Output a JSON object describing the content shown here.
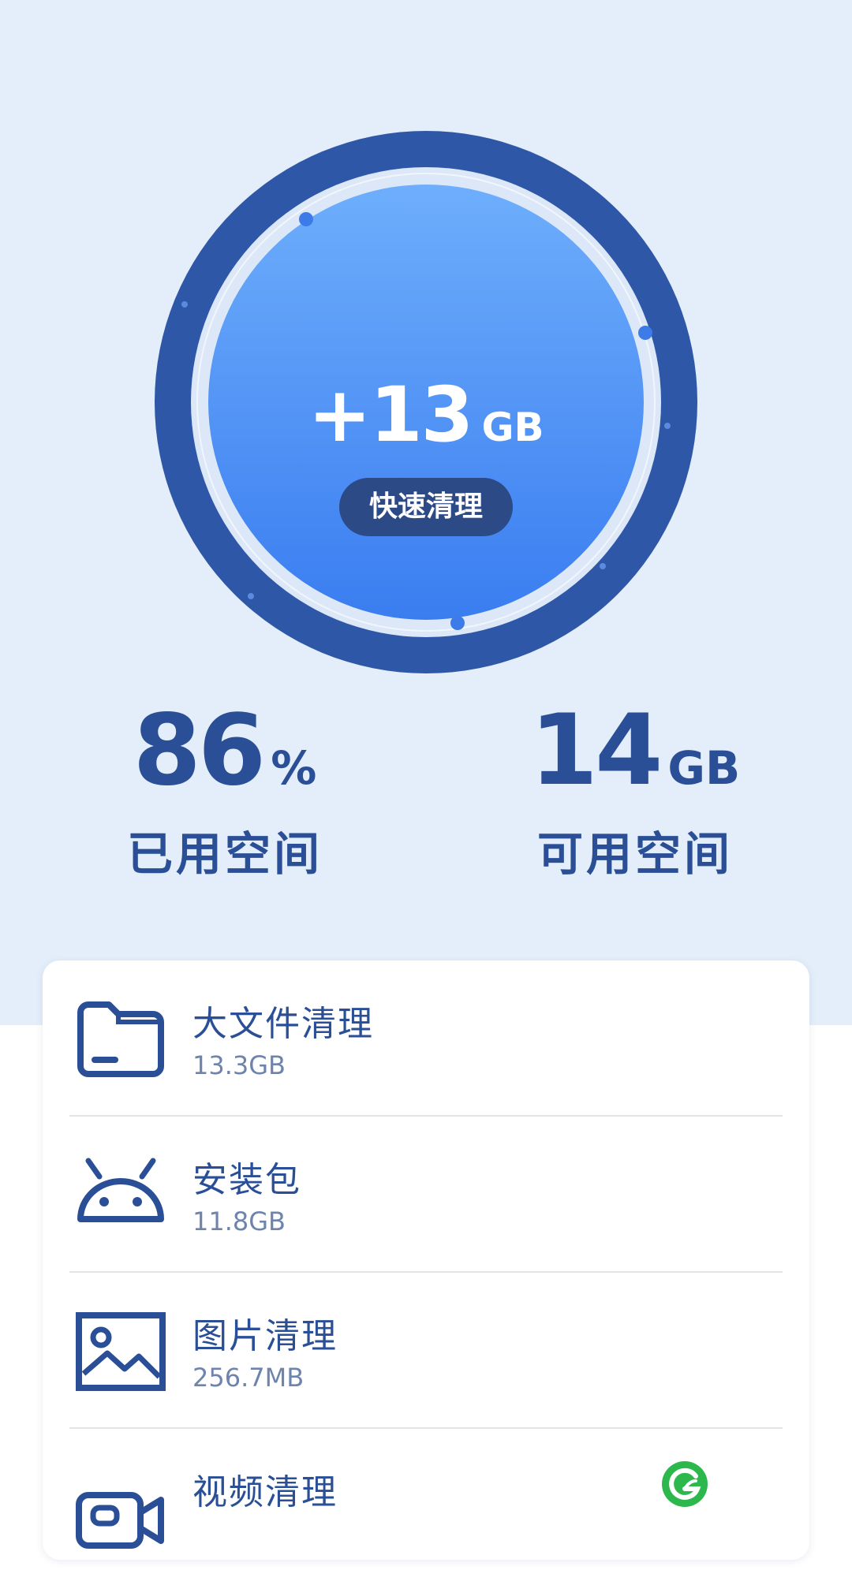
{
  "gauge": {
    "value": "+13",
    "unit": "GB",
    "button_label": "快速清理",
    "used_fraction": 0.86
  },
  "stats": {
    "used": {
      "value": "86",
      "unit": "%",
      "label": "已用空间"
    },
    "free": {
      "value": "14",
      "unit": "GB",
      "label": "可用空间"
    }
  },
  "list": {
    "items": [
      {
        "title": "大文件清理",
        "size": "13.3GB",
        "icon": "folder-icon"
      },
      {
        "title": "安装包",
        "size": "11.8GB",
        "icon": "android-icon"
      },
      {
        "title": "图片清理",
        "size": "256.7MB",
        "icon": "image-icon"
      },
      {
        "title": "视频清理",
        "size": "",
        "icon": "video-icon"
      }
    ]
  },
  "colors": {
    "page_background": "#e3eefa",
    "ring_dark": "#2f57a7",
    "gauge_gradient_top": "#6eaefc",
    "gauge_gradient_bottom": "#3a7df0",
    "text_primary": "#2a4f96",
    "text_secondary": "#6e84ad",
    "button_background": "#2c4a86",
    "logo_green": "#2db84d"
  }
}
